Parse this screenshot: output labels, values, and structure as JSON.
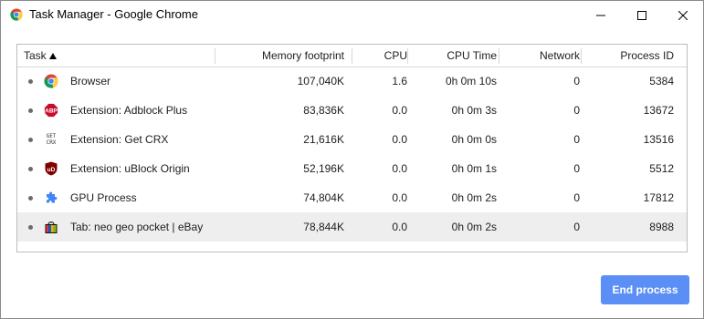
{
  "window": {
    "title": "Task Manager - Google Chrome",
    "controls": {
      "minimize": "minimize-icon",
      "maximize": "maximize-icon",
      "close": "close-icon"
    }
  },
  "table": {
    "columns": {
      "task": "Task",
      "memory": "Memory footprint",
      "cpu": "CPU",
      "cpu_time": "CPU Time",
      "network": "Network",
      "pid": "Process ID"
    },
    "sort": {
      "column": "task",
      "direction": "ascending"
    },
    "rows": [
      {
        "icon": "chrome-icon",
        "task": "Browser",
        "memory": "107,040K",
        "cpu": "1.6",
        "cpu_time": "0h 0m 10s",
        "network": "0",
        "pid": "5384",
        "selected": false
      },
      {
        "icon": "adblock-plus-icon",
        "icon_text": "ABP",
        "task": "Extension: Adblock Plus",
        "memory": "83,836K",
        "cpu": "0.0",
        "cpu_time": "0h 0m 3s",
        "network": "0",
        "pid": "13672",
        "selected": false
      },
      {
        "icon": "get-crx-icon",
        "icon_text": "GET\nCRX",
        "task": "Extension: Get CRX",
        "memory": "21,616K",
        "cpu": "0.0",
        "cpu_time": "0h 0m 0s",
        "network": "0",
        "pid": "13516",
        "selected": false
      },
      {
        "icon": "ublock-origin-icon",
        "icon_text": "uD",
        "task": "Extension: uBlock Origin",
        "memory": "52,196K",
        "cpu": "0.0",
        "cpu_time": "0h 0m 1s",
        "network": "0",
        "pid": "5512",
        "selected": false
      },
      {
        "icon": "puzzle-icon",
        "task": "GPU Process",
        "memory": "74,804K",
        "cpu": "0.0",
        "cpu_time": "0h 0m 2s",
        "network": "0",
        "pid": "17812",
        "selected": false
      },
      {
        "icon": "ebay-bag-icon",
        "task": "Tab: neo geo pocket | eBay",
        "memory": "78,844K",
        "cpu": "0.0",
        "cpu_time": "0h 0m 2s",
        "network": "0",
        "pid": "8988",
        "selected": true
      }
    ]
  },
  "actions": {
    "end_process": "End process"
  },
  "colors": {
    "accent": "#5b8ff5",
    "selected_row": "#eeeeee",
    "border": "#bdbdbd"
  }
}
